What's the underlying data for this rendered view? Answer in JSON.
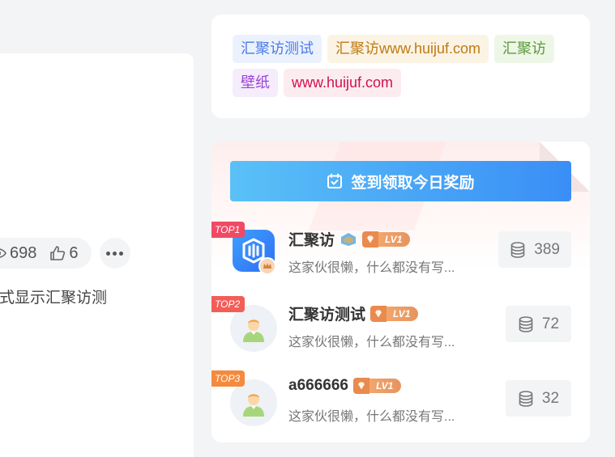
{
  "article": {
    "views": "698",
    "likes": "6",
    "excerpt": "样式显示汇聚访测"
  },
  "tag_cloud": {
    "tags": [
      {
        "label": "汇聚访测试",
        "color": "#4a7be8",
        "bg": "#ecf2fd"
      },
      {
        "label": "汇聚访www.huijuf.com",
        "color": "#c07a12",
        "bg": "#fbf3e4"
      },
      {
        "label": "汇聚访",
        "color": "#5a9a3a",
        "bg": "#eef6e8"
      },
      {
        "label": "壁纸",
        "color": "#9a45d6",
        "bg": "#f5ecfc"
      },
      {
        "label": "www.huijuf.com",
        "color": "#d0124f",
        "bg": "#fcecef"
      }
    ]
  },
  "signin": {
    "button_label": "签到领取今日奖励"
  },
  "ranking": [
    {
      "rank": "TOP1",
      "badge_color": "#f04a64",
      "name": "汇聚访",
      "level": "LV1",
      "bio": "这家伙很懒，什么都没有写...",
      "points": "389"
    },
    {
      "rank": "TOP2",
      "badge_color": "#f25e57",
      "name": "汇聚访测试",
      "level": "LV1",
      "bio": "这家伙很懒，什么都没有写...",
      "points": "72"
    },
    {
      "rank": "TOP3",
      "badge_color": "#f58a3f",
      "name": "a666666",
      "level": "LV1",
      "bio": "这家伙很懒，什么都没有写...",
      "points": "32"
    }
  ]
}
